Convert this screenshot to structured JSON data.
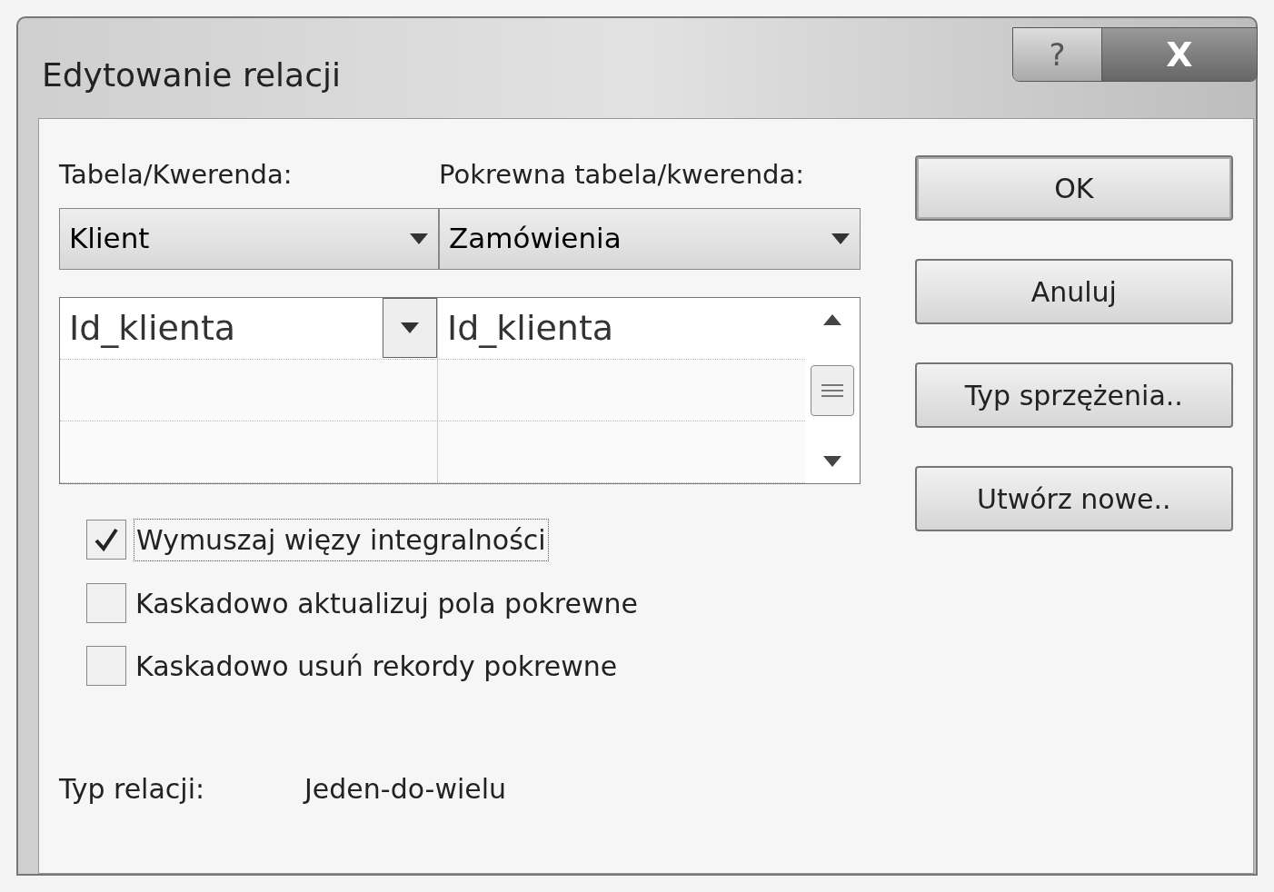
{
  "window": {
    "title": "Edytowanie relacji",
    "help_button": "?",
    "close_button": "X"
  },
  "table_label": "Tabela/Kwerenda:",
  "related_label": "Pokrewna tabela/kwerenda:",
  "table_select": {
    "value": "Klient"
  },
  "related_select": {
    "value": "Zamówienia"
  },
  "field_rows": [
    {
      "left": "Id_klienta",
      "right": "Id_klienta",
      "selected": true
    },
    {
      "left": "",
      "right": "",
      "selected": false
    },
    {
      "left": "",
      "right": "",
      "selected": false
    }
  ],
  "options": [
    {
      "label": "Wymuszaj więzy integralności",
      "checked": true
    },
    {
      "label": "Kaskadowo aktualizuj pola pokrewne",
      "checked": false
    },
    {
      "label": "Kaskadowo usuń rekordy pokrewne",
      "checked": false
    }
  ],
  "relation_type": {
    "label": "Typ relacji:",
    "value": "Jeden-do-wielu"
  },
  "buttons": [
    "OK",
    "Anuluj",
    "Typ sprzężenia..",
    "Utwórz nowe.."
  ]
}
